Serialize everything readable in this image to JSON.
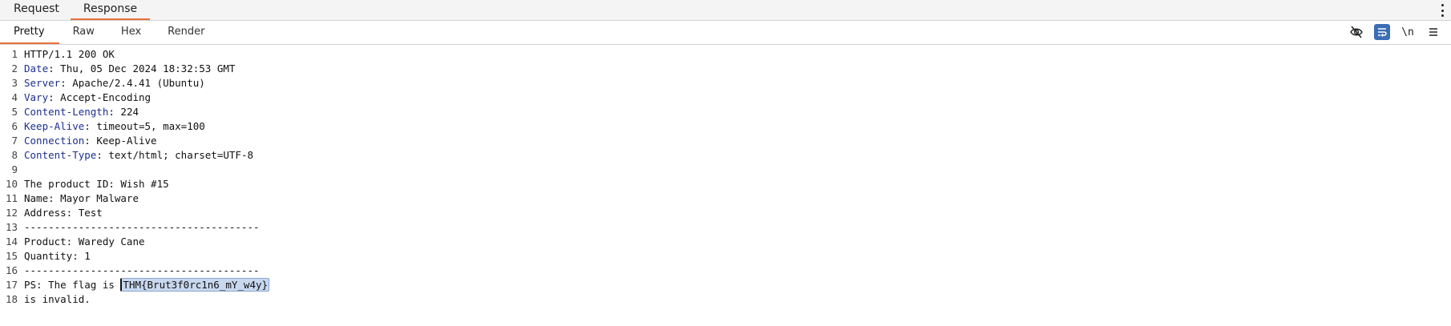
{
  "top_tabs": [
    {
      "label": "Request",
      "active": false
    },
    {
      "label": "Response",
      "active": true
    }
  ],
  "sub_tabs": [
    {
      "label": "Pretty",
      "active": true
    },
    {
      "label": "Raw",
      "active": false
    },
    {
      "label": "Hex",
      "active": false
    },
    {
      "label": "Render",
      "active": false
    }
  ],
  "toolbar": {
    "hide_icon": "eye-slash-icon",
    "wrap_icon": "word-wrap-icon",
    "newline_label": "\\n",
    "menu_icon": "hamburger-menu-icon",
    "accent": "#3c6eb4"
  },
  "colors": {
    "tab_underline": "#e8703a",
    "header_name": "#1c2f8f",
    "selection": "#c8d8ef"
  },
  "response": {
    "lines": [
      {
        "n": "1",
        "name": "",
        "sep": "",
        "value": "HTTP/1.1 200 OK"
      },
      {
        "n": "2",
        "name": "Date",
        "sep": ": ",
        "value": "Thu, 05 Dec 2024 18:32:53 GMT"
      },
      {
        "n": "3",
        "name": "Server",
        "sep": ": ",
        "value": "Apache/2.4.41 (Ubuntu)"
      },
      {
        "n": "4",
        "name": "Vary",
        "sep": ": ",
        "value": "Accept-Encoding"
      },
      {
        "n": "5",
        "name": "Content-Length",
        "sep": ": ",
        "value": "224"
      },
      {
        "n": "6",
        "name": "Keep-Alive",
        "sep": ": ",
        "value": "timeout=5, max=100"
      },
      {
        "n": "7",
        "name": "Connection",
        "sep": ": ",
        "value": "Keep-Alive"
      },
      {
        "n": "8",
        "name": "Content-Type",
        "sep": ": ",
        "value": "text/html; charset=UTF-8"
      },
      {
        "n": "9",
        "name": "",
        "sep": "",
        "value": ""
      },
      {
        "n": "10",
        "name": "",
        "sep": "",
        "value": "The product ID: Wish #15"
      },
      {
        "n": "11",
        "name": "",
        "sep": "",
        "value": "Name: Mayor Malware"
      },
      {
        "n": "12",
        "name": "",
        "sep": "",
        "value": "Address: Test"
      },
      {
        "n": "13",
        "name": "",
        "sep": "",
        "value": "---------------------------------------"
      },
      {
        "n": "14",
        "name": "",
        "sep": "",
        "value": "Product: Waredy Cane"
      },
      {
        "n": "15",
        "name": "",
        "sep": "",
        "value": "Quantity: 1"
      },
      {
        "n": "16",
        "name": "",
        "sep": "",
        "value": "---------------------------------------"
      }
    ],
    "flag_line": {
      "n": "17",
      "prefix": "PS: The flag is ",
      "selected": "THM{Brut3f0rc1n6_mY_w4y}"
    },
    "last_line": {
      "n": "18",
      "value": "is invalid."
    }
  }
}
